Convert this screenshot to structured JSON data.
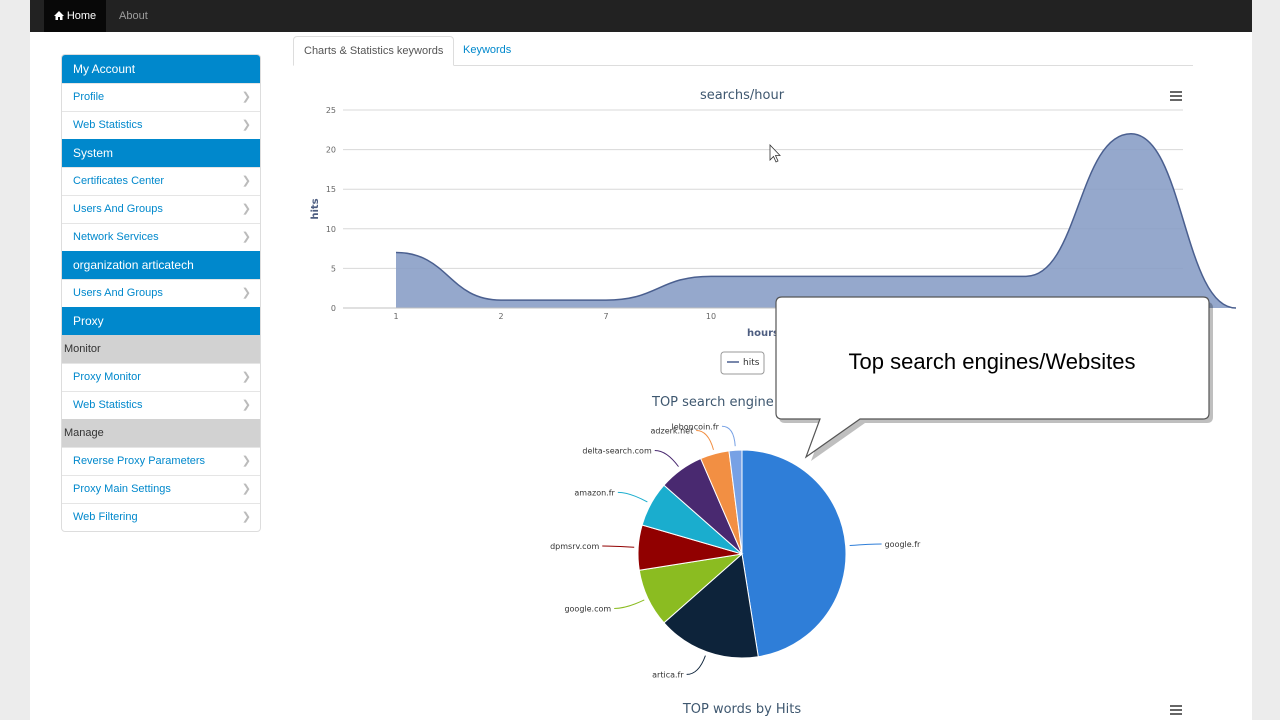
{
  "navbar": {
    "home": "Home",
    "about": "About"
  },
  "sidebar": {
    "my_account": "My Account",
    "profile": "Profile",
    "web_statistics": "Web Statistics",
    "system": "System",
    "certificates_center": "Certificates Center",
    "users_and_groups": "Users And Groups",
    "network_services": "Network Services",
    "org": "organization articatech",
    "org_users_and_groups": "Users And Groups",
    "proxy": "Proxy",
    "monitor": "Monitor",
    "proxy_monitor": "Proxy Monitor",
    "proxy_web_statistics": "Web Statistics",
    "manage": "Manage",
    "reverse_proxy": "Reverse Proxy Parameters",
    "proxy_main_settings": "Proxy Main Settings",
    "web_filtering": "Web Filtering"
  },
  "tabs": {
    "charts": "Charts & Statistics keywords",
    "keywords": "Keywords"
  },
  "callout": {
    "text": "Top search engines/Websites"
  },
  "colors": {
    "brand": "#0088cc",
    "area": "#8a9ec7",
    "line": "#4a5f8f"
  },
  "chart_data": [
    {
      "type": "area",
      "title": "searchs/hour",
      "xlabel": "hours",
      "ylabel": "hits",
      "categories": [
        "1",
        "2",
        "7",
        "10",
        "",
        "",
        "",
        "",
        ""
      ],
      "yticks": [
        "0",
        "5",
        "10",
        "15",
        "20",
        "25"
      ],
      "ylim": [
        0,
        25
      ],
      "series": [
        {
          "name": "hits",
          "values": [
            7,
            1,
            1,
            4,
            4,
            4,
            4,
            22,
            0
          ]
        }
      ],
      "legend": "bottom"
    },
    {
      "type": "pie",
      "title": "TOP search engine",
      "labels": [
        "google.fr",
        "artica.fr",
        "google.com",
        "dpmsrv.com",
        "amazon.fr",
        "delta-search.com",
        "adzerk.net",
        "leboncoin.fr"
      ],
      "values": [
        47.5,
        16,
        9,
        7,
        7,
        7,
        4.5,
        2
      ],
      "colors": [
        "#2f7ed8",
        "#0d233a",
        "#8bbc21",
        "#910000",
        "#1aadce",
        "#492970",
        "#f28f43",
        "#77a1e5"
      ]
    },
    {
      "type": "bar",
      "title": "TOP words by Hits"
    }
  ]
}
